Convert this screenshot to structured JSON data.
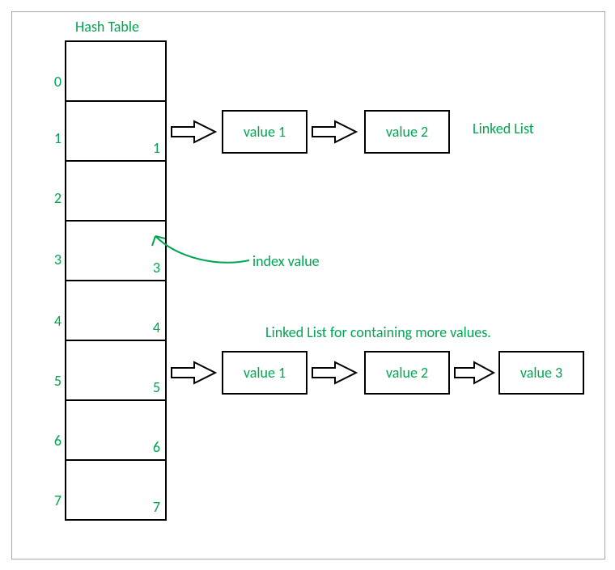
{
  "title": "Hash Table",
  "labels": {
    "linked_list": "Linked List",
    "linked_more": "Linked List for containing more values.",
    "index_value": "index value"
  },
  "rows": [
    {
      "outer": "0",
      "inner": ""
    },
    {
      "outer": "1",
      "inner": "1"
    },
    {
      "outer": "2",
      "inner": ""
    },
    {
      "outer": "3",
      "inner": "3"
    },
    {
      "outer": "4",
      "inner": "4"
    },
    {
      "outer": "5",
      "inner": "5"
    },
    {
      "outer": "6",
      "inner": "6"
    },
    {
      "outer": "7",
      "inner": "7"
    }
  ],
  "chain1": {
    "node1": "value 1",
    "node2": "value 2"
  },
  "chain5": {
    "node1": "value 1",
    "node2": "value 2",
    "node3": "value 3"
  },
  "chart_data": {
    "type": "table",
    "structure": "hash-table-with-chaining",
    "buckets": 8,
    "entries": [
      {
        "index": 0,
        "stored_index": null,
        "chain": []
      },
      {
        "index": 1,
        "stored_index": 1,
        "chain": [
          "value 1",
          "value 2"
        ]
      },
      {
        "index": 2,
        "stored_index": null,
        "chain": []
      },
      {
        "index": 3,
        "stored_index": 3,
        "chain": []
      },
      {
        "index": 4,
        "stored_index": 4,
        "chain": []
      },
      {
        "index": 5,
        "stored_index": 5,
        "chain": [
          "value 1",
          "value 2",
          "value 3"
        ]
      },
      {
        "index": 6,
        "stored_index": 6,
        "chain": []
      },
      {
        "index": 7,
        "stored_index": 7,
        "chain": []
      }
    ],
    "annotations": [
      "Linked List",
      "index value",
      "Linked List for containing more values."
    ],
    "title": "Hash Table"
  }
}
